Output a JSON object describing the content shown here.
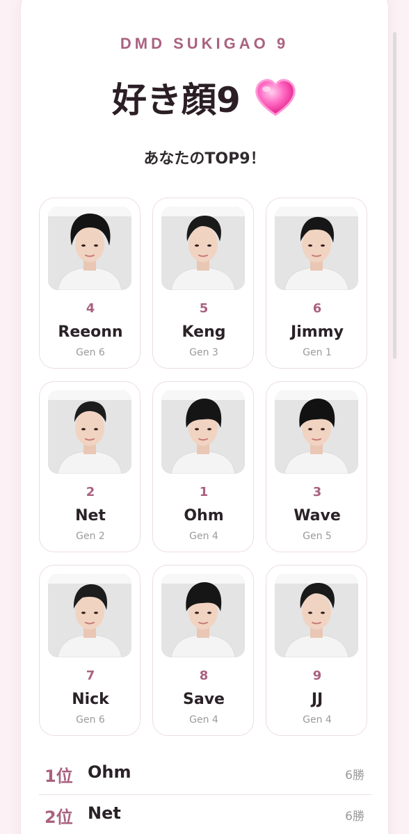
{
  "header": {
    "brand": "DMD SUKIGAO 9",
    "title": "好き顔9",
    "heart_color": "#ff3fa8",
    "subtitle": "あなたのTOP9！"
  },
  "members": [
    {
      "rank": "4",
      "name": "Reeonn",
      "gen": "Gen 6",
      "hair": "#141414",
      "style": "fluffy"
    },
    {
      "rank": "5",
      "name": "Keng",
      "gen": "Gen 3",
      "hair": "#1a1a1a",
      "style": "swept"
    },
    {
      "rank": "6",
      "name": "Jimmy",
      "gen": "Gen 1",
      "hair": "#161616",
      "style": "side"
    },
    {
      "rank": "2",
      "name": "Net",
      "gen": "Gen 2",
      "hair": "#1c1c1c",
      "style": "short"
    },
    {
      "rank": "1",
      "name": "Ohm",
      "gen": "Gen 4",
      "hair": "#151515",
      "style": "fringe"
    },
    {
      "rank": "3",
      "name": "Wave",
      "gen": "Gen 5",
      "hair": "#121212",
      "style": "fringe"
    },
    {
      "rank": "7",
      "name": "Nick",
      "gen": "Gen 6",
      "hair": "#1d1d1d",
      "style": "side"
    },
    {
      "rank": "8",
      "name": "Save",
      "gen": "Gen 4",
      "hair": "#161616",
      "style": "fringe"
    },
    {
      "rank": "9",
      "name": "JJ",
      "gen": "Gen 4",
      "hair": "#1a1a1a",
      "style": "swept"
    }
  ],
  "ranking": [
    {
      "pos": "1位",
      "name": "Ohm",
      "wins": "6勝"
    },
    {
      "pos": "2位",
      "name": "Net",
      "wins": "6勝"
    }
  ],
  "colors": {
    "accent": "#a9627f",
    "background": "#fcf1f5"
  }
}
